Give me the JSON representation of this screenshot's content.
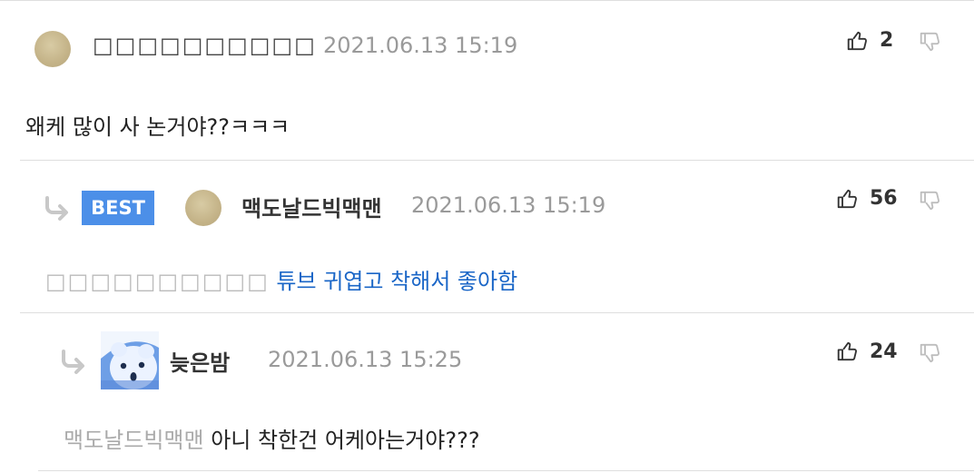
{
  "comments": [
    {
      "username": "□□□□□□□□□□",
      "time": "2021.06.13 15:19",
      "likes": "2",
      "text": "왜케 많이 사 논거야??ㅋㅋㅋ"
    },
    {
      "badge": "BEST",
      "username": "맥도날드빅맥맨",
      "time": "2021.06.13 15:19",
      "likes": "56",
      "mention": "□□□□□□□□□□",
      "text": "튜브 귀엽고 착해서 좋아함"
    },
    {
      "username": "늦은밤",
      "time": "2021.06.13 15:25",
      "likes": "24",
      "mention": "맥도날드빅맥맨",
      "text": "아니 착한건 어케아는거야???"
    }
  ],
  "icons": {
    "like": "thumbs-up-icon",
    "dislike": "thumbs-down-icon",
    "reply": "reply-arrow-icon"
  },
  "colors": {
    "best_badge": "#4c8fe8",
    "link_text": "#1a66c7",
    "meta_gray": "#9a9a9a"
  }
}
